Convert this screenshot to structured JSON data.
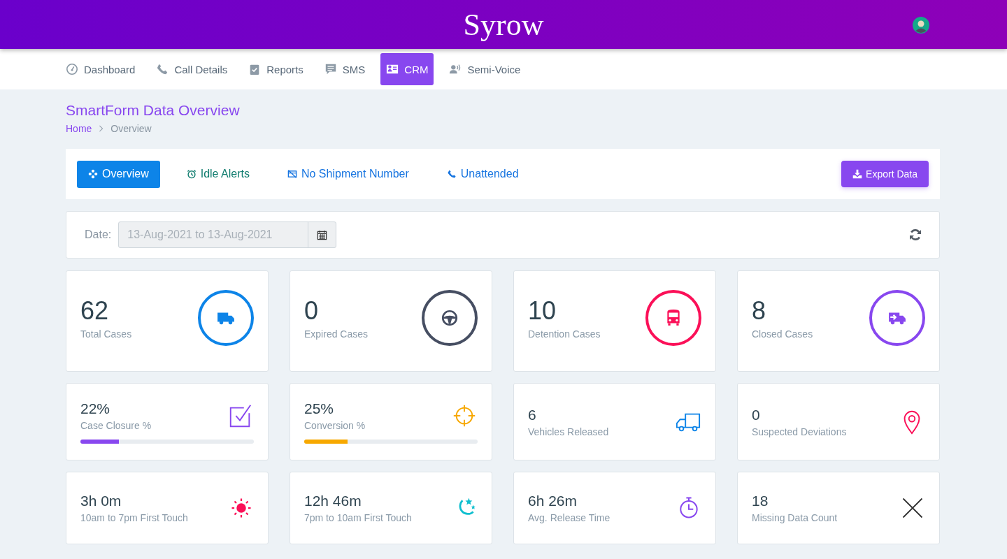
{
  "header": {
    "logo": "Syrow"
  },
  "nav": [
    {
      "label": "Dashboard",
      "kind": "gauge",
      "selected": false
    },
    {
      "label": "Call Details",
      "kind": "phone",
      "selected": false
    },
    {
      "label": "Reports",
      "kind": "clipboard",
      "selected": false
    },
    {
      "label": "SMS",
      "kind": "chat",
      "selected": false
    },
    {
      "label": "CRM",
      "kind": "idcard",
      "selected": true
    },
    {
      "label": "Semi-Voice",
      "kind": "voice",
      "selected": false
    }
  ],
  "page": {
    "title": "SmartForm Data Overview",
    "breadcrumb": [
      {
        "label": "Home",
        "kind": "link"
      },
      {
        "label": "Overview",
        "kind": "current"
      }
    ]
  },
  "subtabs": [
    {
      "label": "Overview",
      "kind": "move",
      "selected": true,
      "color": "#0d84e8"
    },
    {
      "label": "Idle Alerts",
      "kind": "alarm",
      "selected": false,
      "color": "#0f7c6e"
    },
    {
      "label": "No Shipment Number",
      "kind": "nocard",
      "selected": false,
      "color": "#1674e0"
    },
    {
      "label": "Unattended",
      "kind": "phone",
      "selected": false,
      "color": "#1674e0"
    }
  ],
  "export_button": "Export Data",
  "date_filter": {
    "label": "Date:",
    "value": "13-Aug-2021 to 13-Aug-2021",
    "disabled": true
  },
  "stat_cards": [
    {
      "value": "62",
      "label": "Total Cases",
      "kind": "truck",
      "color": "#0d84e8"
    },
    {
      "value": "0",
      "label": "Expired Cases",
      "kind": "wheel",
      "color": "#464e62"
    },
    {
      "value": "10",
      "label": "Detention Cases",
      "kind": "bus",
      "color": "#fb1058"
    },
    {
      "value": "8",
      "label": "Closed Cases",
      "kind": "truckarrow",
      "color": "#8847ef"
    }
  ],
  "metric_cards": [
    {
      "value": "22%",
      "label": "Case Closure %",
      "kind": "checkbox",
      "color": "#8847ef",
      "level": 0.22
    },
    {
      "value": "25%",
      "label": "Conversion %",
      "kind": "crosshair",
      "color": "#f7a800",
      "level": 0.25
    },
    {
      "value": "6",
      "label": "Vehicles Released",
      "kind": "truckoutline",
      "color": "#0d84e8"
    },
    {
      "value": "0",
      "label": "Suspected Deviations",
      "kind": "pin",
      "color": "#fb1058"
    }
  ],
  "time_cards": [
    {
      "value": "3h 0m",
      "label": "10am to 7pm First Touch",
      "kind": "sun",
      "color": "#fb1058"
    },
    {
      "value": "12h 46m",
      "label": "7pm to 10am First Touch",
      "kind": "moon",
      "color": "#10bfcf"
    },
    {
      "value": "6h 26m",
      "label": "Avg. Release Time",
      "kind": "stopwatch",
      "color": "#8847ef"
    },
    {
      "value": "18",
      "label": "Missing Data Count",
      "kind": "cross",
      "color": "#333333"
    }
  ]
}
